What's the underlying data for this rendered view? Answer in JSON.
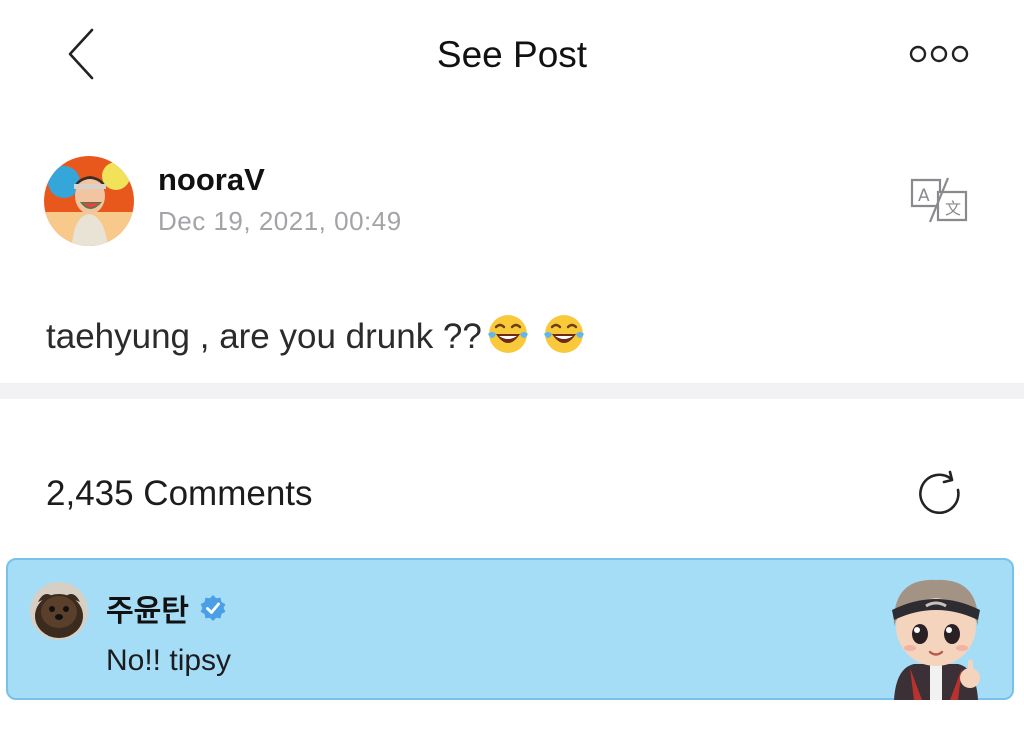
{
  "header": {
    "title": "See Post",
    "back_icon": "chevron-left-icon",
    "more_icon": "more-horizontal-icon"
  },
  "post": {
    "author": "nooraV",
    "date": "Dec 19, 2021, 00:49",
    "text": "taehyung , are you drunk ??",
    "emojis": [
      "tears-of-joy-emoji",
      "tears-of-joy-emoji"
    ],
    "translate_icon": "translate-icon"
  },
  "comments": {
    "count_label": "2,435 Comments",
    "refresh_icon": "refresh-icon",
    "highlighted": {
      "author": "주윤탄",
      "verified_icon": "verified-badge-icon",
      "text": "No!! tipsy",
      "sticker": "character-sticker",
      "highlight_color": "#a5dcf6"
    }
  },
  "colors": {
    "badge_blue": "#4a9fe6",
    "date_gray": "#a3a3a8",
    "divider": "#f2f2f5"
  }
}
